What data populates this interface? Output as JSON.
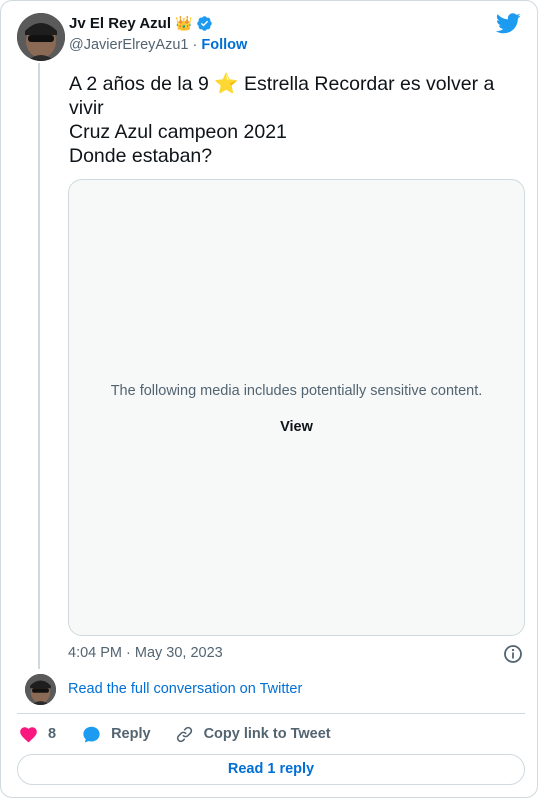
{
  "author": {
    "name": "Jv El Rey Azul",
    "emoji": "👑",
    "handle": "@JavierElreyAzu1",
    "separator": "·",
    "follow_label": "Follow"
  },
  "tweet": {
    "line1": "A 2 años de la 9 ⭐ Estrella Recordar es volver a vivir",
    "line2": "Cruz Azul campeon 2021",
    "line3": "Donde estaban?"
  },
  "media": {
    "warning": "The following media includes potentially sensitive content.",
    "view_label": "View"
  },
  "timestamp": "4:04 PM · May 30, 2023",
  "read_full_label": "Read the full conversation on Twitter",
  "actions": {
    "like_count": "8",
    "reply_label": "Reply",
    "copy_label": "Copy link to Tweet"
  },
  "read_replies_label": "Read 1 reply",
  "colors": {
    "link": "#006fd6",
    "verified": "#1d9bf0",
    "like": "#f91880",
    "border": "#cfd9de"
  },
  "icons": [
    "twitter-bird-icon",
    "verified-badge-icon",
    "info-icon",
    "heart-icon",
    "reply-bubble-icon",
    "link-icon"
  ]
}
